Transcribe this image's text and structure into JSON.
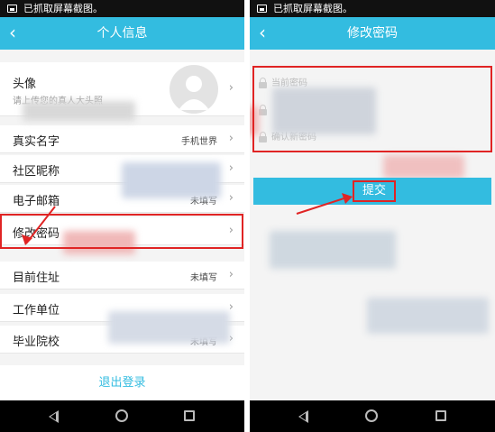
{
  "status_bar": {
    "text": "已抓取屏幕截图。"
  },
  "left_screen": {
    "title": "个人信息",
    "avatar_row": {
      "label": "头像",
      "hint": "请上传您的真人大头照"
    },
    "rows": [
      {
        "label": "真实名字",
        "value": "手机世界"
      },
      {
        "label": "社区昵称",
        "value": ""
      },
      {
        "label": "电子邮箱",
        "value": "未填写"
      },
      {
        "label": "修改密码",
        "value": ""
      },
      {
        "label": "目前住址",
        "value": "未填写"
      },
      {
        "label": "工作单位",
        "value": ""
      },
      {
        "label": "毕业院校",
        "value": "未填写"
      }
    ],
    "logout": "退出登录"
  },
  "right_screen": {
    "title": "修改密码",
    "fields": [
      {
        "placeholder": "当前密码"
      },
      {
        "placeholder": ""
      },
      {
        "placeholder": "确认新密码"
      }
    ],
    "submit": "提交"
  },
  "colors": {
    "accent": "#33bce0",
    "highlight": "#e02424"
  },
  "icons": {
    "back": "chevron-left-icon",
    "row_arrow": "chevron-right-icon",
    "field": "lock-icon",
    "nav": [
      "nav-back-icon",
      "nav-home-icon",
      "nav-recent-icon"
    ]
  }
}
